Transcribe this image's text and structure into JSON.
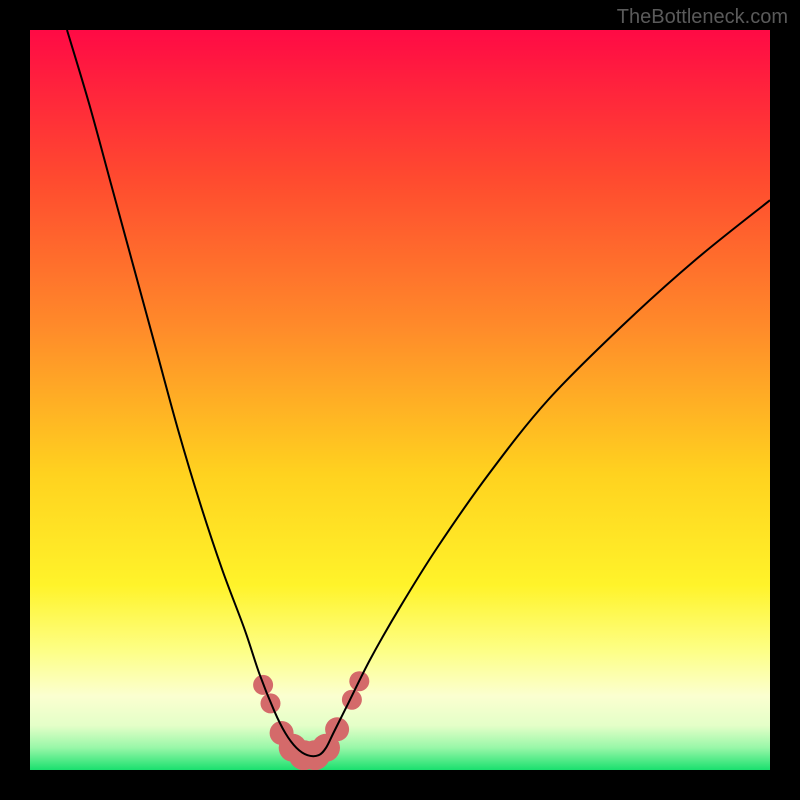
{
  "watermark": "TheBottleneck.com",
  "chart_data": {
    "type": "line",
    "title": "",
    "xlabel": "",
    "ylabel": "",
    "xlim": [
      0,
      100
    ],
    "ylim": [
      0,
      100
    ],
    "background_gradient": {
      "stops": [
        {
          "pos": 0.0,
          "color": "#ff0a45"
        },
        {
          "pos": 0.2,
          "color": "#ff4a2f"
        },
        {
          "pos": 0.4,
          "color": "#ff8a2a"
        },
        {
          "pos": 0.6,
          "color": "#ffd21f"
        },
        {
          "pos": 0.75,
          "color": "#fff32a"
        },
        {
          "pos": 0.84,
          "color": "#fdff87"
        },
        {
          "pos": 0.9,
          "color": "#fbffd0"
        },
        {
          "pos": 0.94,
          "color": "#e4ffc8"
        },
        {
          "pos": 0.97,
          "color": "#98f7a8"
        },
        {
          "pos": 1.0,
          "color": "#1ae06e"
        }
      ]
    },
    "series": [
      {
        "name": "bottleneck-curve",
        "stroke": "#000000",
        "stroke_width": 2,
        "x": [
          5,
          8,
          11,
          14,
          17,
          20,
          23,
          26,
          29,
          31,
          33,
          34.5,
          36,
          37.5,
          39,
          40,
          41,
          43,
          46,
          50,
          55,
          62,
          70,
          80,
          90,
          100
        ],
        "y": [
          100,
          90,
          79,
          68,
          57,
          46,
          36,
          27,
          19,
          13,
          8,
          5,
          3,
          2,
          2,
          3,
          5,
          9,
          15,
          22,
          30,
          40,
          50,
          60,
          69,
          77
        ]
      }
    ],
    "markers": {
      "name": "highlight-band",
      "color": "#d46a6a",
      "points": [
        {
          "x": 31.5,
          "y": 11.5,
          "r": 10
        },
        {
          "x": 32.5,
          "y": 9.0,
          "r": 10
        },
        {
          "x": 34.0,
          "y": 5.0,
          "r": 12
        },
        {
          "x": 35.5,
          "y": 3.0,
          "r": 14
        },
        {
          "x": 37.0,
          "y": 2.0,
          "r": 15
        },
        {
          "x": 38.5,
          "y": 2.0,
          "r": 15
        },
        {
          "x": 40.0,
          "y": 3.0,
          "r": 14
        },
        {
          "x": 41.5,
          "y": 5.5,
          "r": 12
        },
        {
          "x": 43.5,
          "y": 9.5,
          "r": 10
        },
        {
          "x": 44.5,
          "y": 12.0,
          "r": 10
        }
      ]
    }
  }
}
